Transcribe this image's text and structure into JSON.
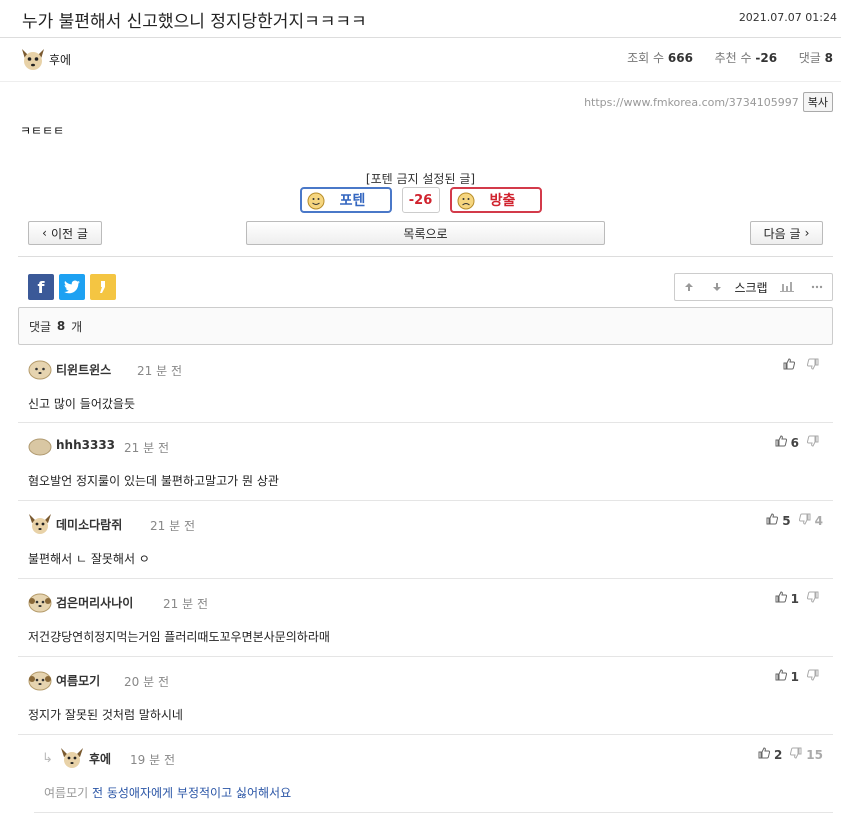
{
  "post": {
    "title": "누가 불편해서 신고했으니 정지당한거지ㅋㅋㅋㅋ",
    "date": "2021.07.07 01:24",
    "author": "후에",
    "views_label": "조회 수",
    "views": "666",
    "recommend_label": "추천 수",
    "recommend": "-26",
    "comments_label": "댓글",
    "comments": "8",
    "url": "https://www.fmkorea.com/3734105997",
    "copy_label": "복사",
    "body": "ㅋㅌㅌㅌ"
  },
  "vote": {
    "banned_label": "[포텐 금지 설정된 글]",
    "up_label": "포텐",
    "count": "-26",
    "down_label": "방출"
  },
  "nav": {
    "prev": "이전 글",
    "list": "목록으로",
    "next": "다음 글"
  },
  "tools": {
    "scrap": "스크랩"
  },
  "comment_header": {
    "prefix": "댓글",
    "count": "8",
    "suffix": "개"
  },
  "comments": [
    {
      "author": "티윈트윈스",
      "time": "21 분 전",
      "text": "신고 많이 들어갔을듯",
      "up": "",
      "down": ""
    },
    {
      "author": "hhh3333",
      "time": "21 분 전",
      "text": "혐오발언 정지룰이 있는데 불편하고말고가 뭔 상관",
      "up": "6",
      "down": ""
    },
    {
      "author": "데미소다람쥐",
      "time": "21 분 전",
      "text": "불편해서 ㄴ 잘못해서 ㅇ",
      "up": "5",
      "down": "4"
    },
    {
      "author": "검은머리사나이",
      "time": "21 분 전",
      "text": "저건걍당연히정지먹는거임 플러리때도꼬우면본사문의하라매",
      "up": "1",
      "down": ""
    },
    {
      "author": "여름모기",
      "time": "20 분 전",
      "text": "정지가 잘못된 것처럼 말하시네",
      "up": "1",
      "down": ""
    },
    {
      "author": "후에",
      "time": "19 분 전",
      "reply_to": "여름모기",
      "text": "전 동성애자에게 부정적이고 싫어해서요",
      "up": "2",
      "down": "15"
    }
  ],
  "colors": {
    "up_accent": "#3567c0",
    "down_accent": "#d0232e",
    "facebook": "#3b5998",
    "twitter": "#1da1f2",
    "kakao": "#f4c542"
  }
}
